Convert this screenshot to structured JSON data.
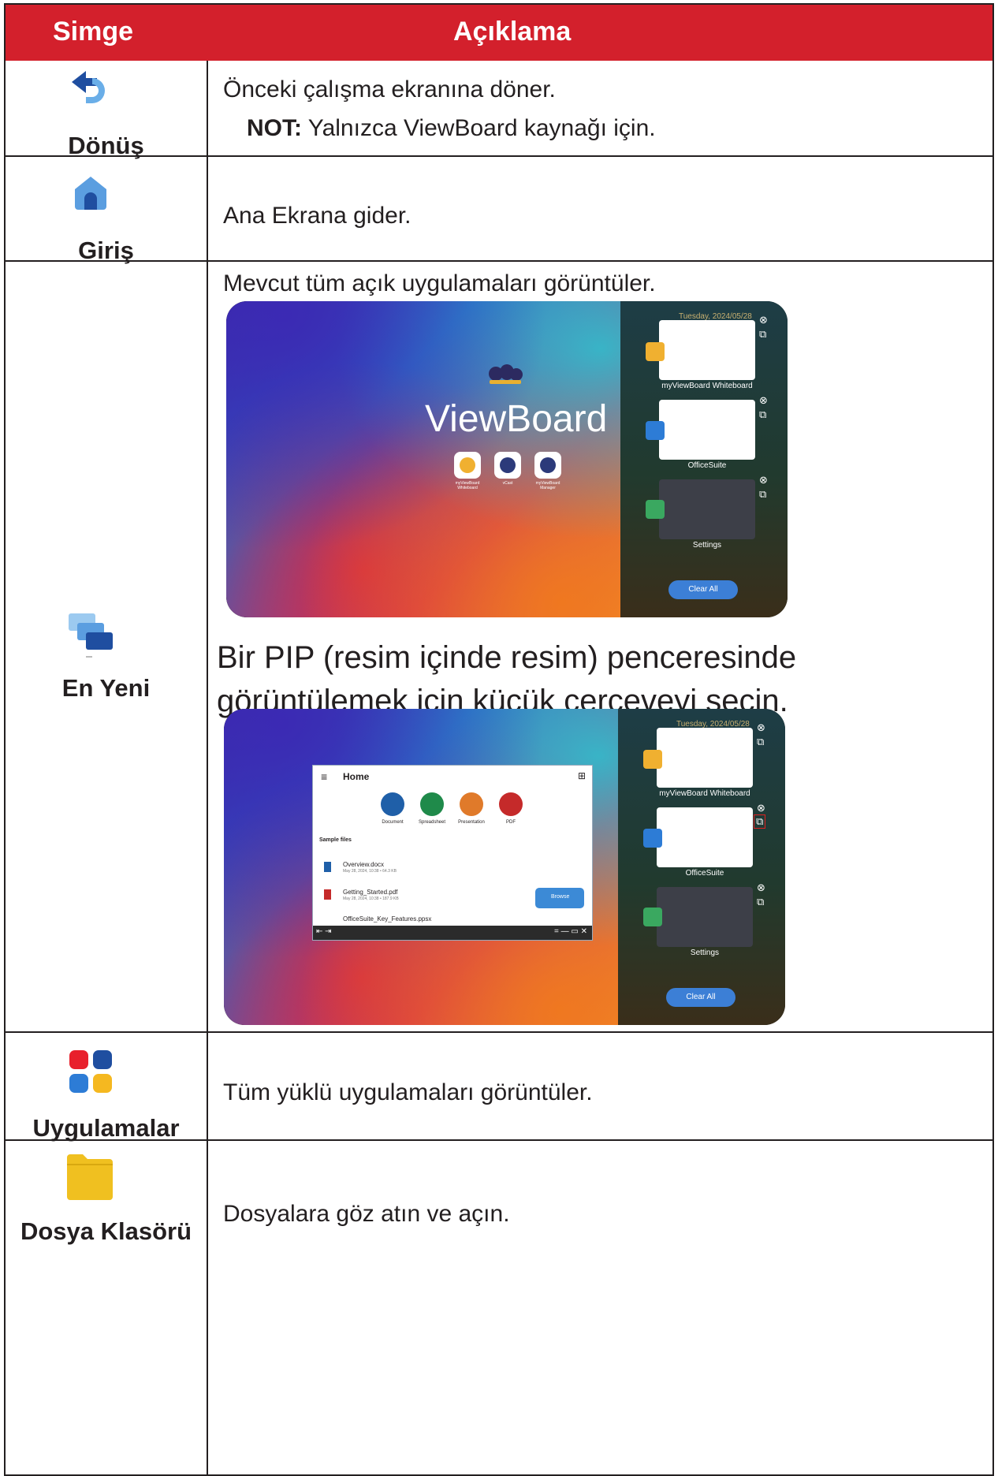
{
  "header": {
    "col1": "Simge",
    "col2": "Açıklama"
  },
  "rows": [
    {
      "label": "Dönüş",
      "icon": "return-icon",
      "desc": "Önceki çalışma ekranına döner.",
      "note_bold": "NOT:",
      "note_text": " Yalnızca ViewBoard kaynağı için."
    },
    {
      "label": "Giriş",
      "icon": "home-icon",
      "desc": "Ana Ekrana gider."
    },
    {
      "label": "En Yeni",
      "icon": "recent-windows-icon",
      "desc": "Mevcut tüm açık uygulamaları görüntüler.",
      "desc2": "Bir PIP (resim içinde resim) penceresinde görüntülemek için küçük çerçeveyi seçin."
    },
    {
      "label": "Uygulamalar",
      "icon": "apps-grid-icon",
      "desc": "Tüm yüklü uygulamaları görüntüler."
    },
    {
      "label": "Dosya Klasörü",
      "icon": "folder-icon",
      "desc": "Dosyalara göz atın ve açın."
    }
  ],
  "screenshot1": {
    "date": "Tuesday, 2024/05/28",
    "brand": "ViewBoard",
    "apps": [
      "myViewBoard Whiteboard",
      "vCast",
      "myViewBoard Manager"
    ],
    "cards": [
      "myViewBoard Whiteboard",
      "OfficeSuite",
      "Settings"
    ],
    "clear_all": "Clear All"
  },
  "screenshot2": {
    "date": "Tuesday, 2024/05/28",
    "pip_title": "Home",
    "doc_types": [
      "Document",
      "Spreadsheet",
      "Presentation",
      "PDF"
    ],
    "sample_files_label": "Sample files",
    "files": [
      {
        "name": "Overview.docx",
        "meta": "May 28, 2024, 10:38 • 64.3 KB"
      },
      {
        "name": "Getting_Started.pdf",
        "meta": "May 28, 2024, 10:38 • 187.9 KB"
      },
      {
        "name": "OfficeSuite_Key_Features.ppsx",
        "meta": ""
      }
    ],
    "browse": "Browse",
    "cards": [
      "myViewBoard Whiteboard",
      "OfficeSuite",
      "Settings"
    ],
    "clear_all": "Clear All"
  },
  "colors": {
    "header_bg": "#d3202c",
    "accent_blue": "#1f5fa8"
  }
}
